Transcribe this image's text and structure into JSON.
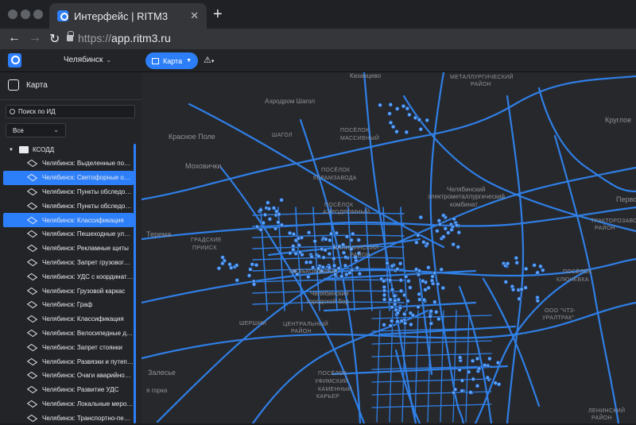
{
  "browser": {
    "tab_title": "Интерфейс | RITM3",
    "tab_close": "✕",
    "new_tab": "+",
    "url_proto": "https://",
    "url_host": "app.ritm3.ru"
  },
  "header": {
    "city": "Челябинск",
    "map_button": "Карта"
  },
  "sidebar": {
    "title": "Карта",
    "search_placeholder": "Поиск по ИД",
    "filter_value": "Все",
    "folder": "КСОДД",
    "items": [
      {
        "label": "Челябинск: Выделенные полосы",
        "selected": false
      },
      {
        "label": "Челябинск: Светофорные объекты",
        "selected": true
      },
      {
        "label": "Челябинск: Пункты обследования",
        "selected": false
      },
      {
        "label": "Челябинск: Пункты обследования",
        "selected": false
      },
      {
        "label": "Челябинск: Классификация",
        "selected": true
      },
      {
        "label": "Челябинск: Пешеходные улицы",
        "selected": false
      },
      {
        "label": "Челябинск: Рекламные щиты",
        "selected": false
      },
      {
        "label": "Челябинск: Запрет грузового движения",
        "selected": false
      },
      {
        "label": "Челябинск: УДС с координатами",
        "selected": false
      },
      {
        "label": "Челябинск: Грузовой каркас",
        "selected": false
      },
      {
        "label": "Челябинск: Граф",
        "selected": false
      },
      {
        "label": "Челябинск: Классификация",
        "selected": false
      },
      {
        "label": "Челябинск: Велосипедные дорожки",
        "selected": false
      },
      {
        "label": "Челябинск: Запрет стоянки",
        "selected": false
      },
      {
        "label": "Челябинск: Развязки и путепроводы",
        "selected": false
      },
      {
        "label": "Челябинск: Очаги аварийности",
        "selected": false
      },
      {
        "label": "Челябинск: Развитие УДС",
        "selected": false
      },
      {
        "label": "Челябинск: Локальные мероприятия",
        "selected": false
      },
      {
        "label": "Челябинск: Транспортно-пересадочные узлы",
        "selected": false
      }
    ]
  },
  "map": {
    "road_color": "#2f7fe6",
    "node_color": "#5aa2ff",
    "background": "#27282c",
    "labels": [
      {
        "text": "Казанцево",
        "caps": false
      },
      {
        "text": "МЕТАЛЛУРГИЧЕСКИЙ",
        "caps": true
      },
      {
        "text": "РАЙОН",
        "caps": true
      },
      {
        "text": "Аэродром Шагол",
        "caps": false
      },
      {
        "text": "Круглое",
        "caps": false
      },
      {
        "text": "Красное Поле",
        "caps": false
      },
      {
        "text": "ШАГОЛ",
        "caps": true
      },
      {
        "text": "ПОСЁЛОК",
        "caps": true
      },
      {
        "text": "МАССИВНЫЙ",
        "caps": true
      },
      {
        "text": "Моховички",
        "caps": false
      },
      {
        "text": "ПОСЁЛОК",
        "caps": true
      },
      {
        "text": "КЕРАМЗАВОДА",
        "caps": true
      },
      {
        "text": "Челябинский",
        "caps": false
      },
      {
        "text": "электрометаллургический",
        "caps": false
      },
      {
        "text": "комбинат",
        "caps": false
      },
      {
        "text": "Первое",
        "caps": false
      },
      {
        "text": "ПОСЁЛОК",
        "caps": true
      },
      {
        "text": "АЭРОДРОМНЫЙ",
        "caps": true
      },
      {
        "text": "ТРАКТОРОЗАВОДСКИЙ",
        "caps": true
      },
      {
        "text": "РАЙОН",
        "caps": true
      },
      {
        "text": "Терема",
        "caps": false
      },
      {
        "text": "ГРАДСКИЕ",
        "caps": true
      },
      {
        "text": "ПРИИСК",
        "caps": true
      },
      {
        "text": "КАЛИНИНСКИЙ",
        "caps": true
      },
      {
        "text": "РАЙОН",
        "caps": true
      },
      {
        "text": "МЕЛЬКОМБИНАТ",
        "caps": true
      },
      {
        "text": "ПОСЁЛОК",
        "caps": true
      },
      {
        "text": "КЛЮЧЁВКА",
        "caps": true
      },
      {
        "text": "Челябинский",
        "caps": false
      },
      {
        "text": "городской бор",
        "caps": false
      },
      {
        "text": "ООО \"ЧТЗ-",
        "caps": true
      },
      {
        "text": "УРАЛТРАК\"",
        "caps": true
      },
      {
        "text": "ШЕРШНИ",
        "caps": true
      },
      {
        "text": "ЦЕНТРАЛЬНЫЙ",
        "caps": true
      },
      {
        "text": "РАЙОН",
        "caps": true
      },
      {
        "text": "Залесье",
        "caps": false
      },
      {
        "text": "ПОСЁЛОК",
        "caps": true
      },
      {
        "text": "УФИМСКИЙ",
        "caps": true
      },
      {
        "text": "КАМЕННЫЙ",
        "caps": true
      },
      {
        "text": "КАРЬЕР",
        "caps": true
      },
      {
        "text": "я горка",
        "caps": false
      },
      {
        "text": "ЛЕНИНСКИЙ",
        "caps": true
      },
      {
        "text": "РАЙОН",
        "caps": true
      }
    ]
  }
}
